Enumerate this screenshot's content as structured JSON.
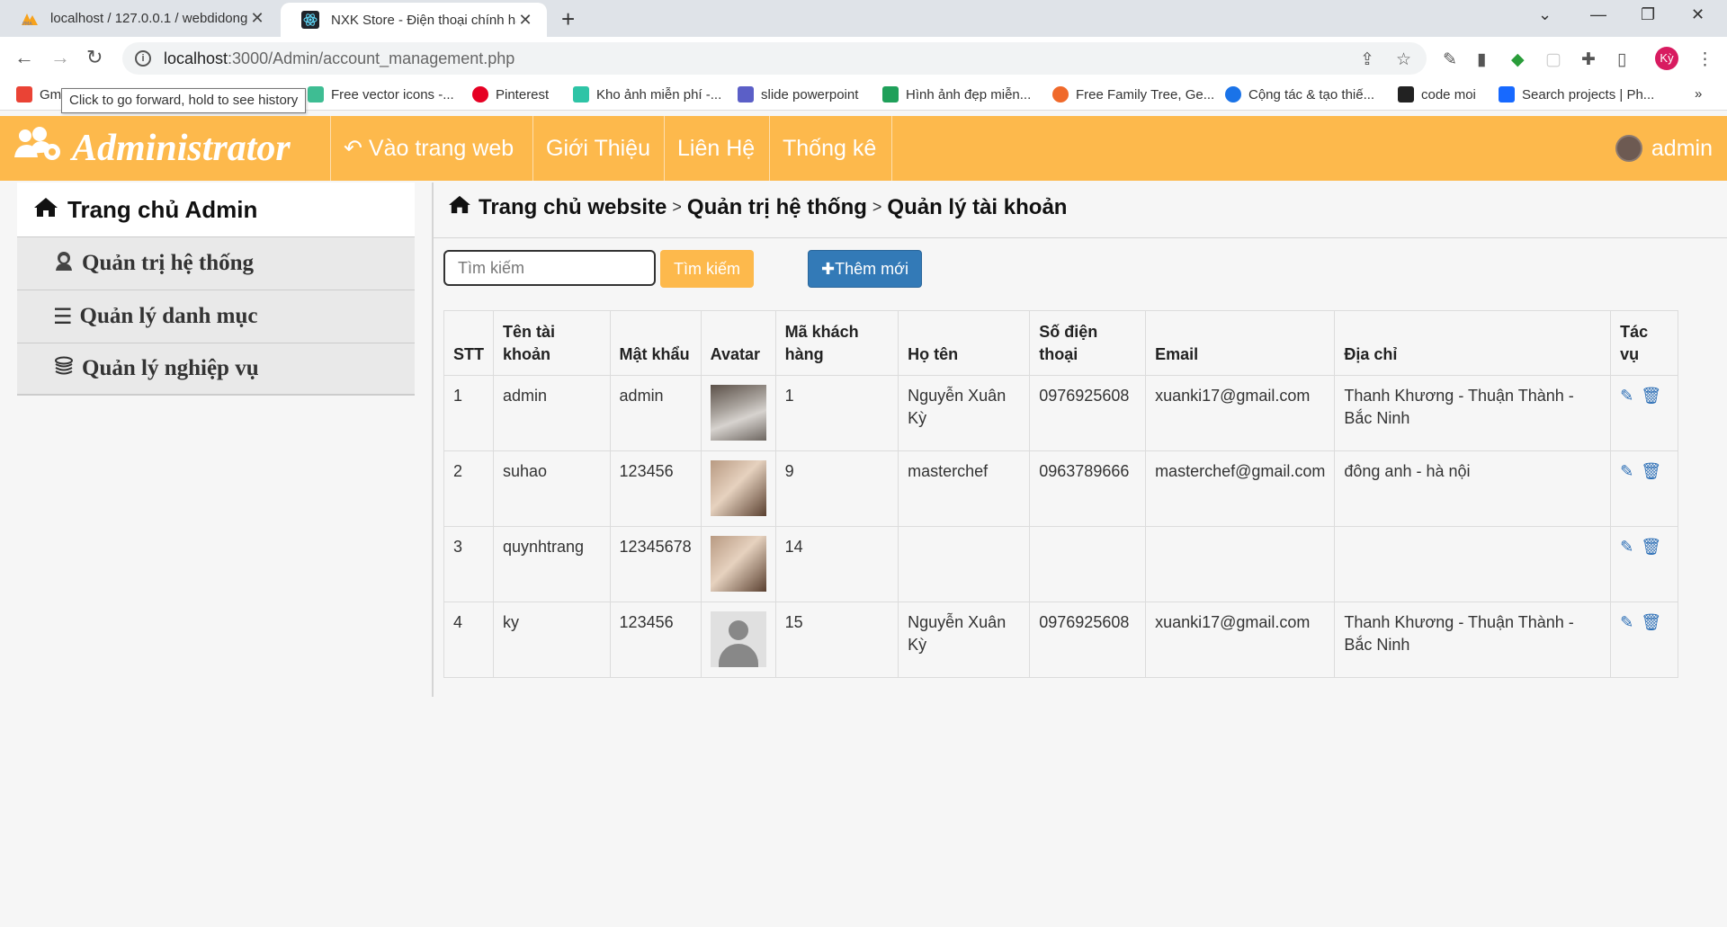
{
  "browser": {
    "tabs": [
      {
        "title": "localhost / 127.0.0.1 / webdidong",
        "icon": "phpmyadmin-icon"
      },
      {
        "title": "NXK Store - Điện thoại chính hãn",
        "icon": "react-icon"
      }
    ],
    "url_host": "localhost",
    "url_path": ":3000/Admin/account_management.php",
    "profile_initials": "Kỳ",
    "tooltip": "Click to go forward, hold to see history",
    "bookmarks": [
      {
        "label": "Gm",
        "color": "#ea4335"
      },
      {
        "label": "Free vector icons -...",
        "color": "#3ebd93"
      },
      {
        "label": "Pinterest",
        "color": "#e60023"
      },
      {
        "label": "Kho ảnh miễn phí -...",
        "color": "#2ec4a6"
      },
      {
        "label": "slide powerpoint",
        "color": "#5b5fc7"
      },
      {
        "label": "Hình ảnh đẹp miễn...",
        "color": "#1fa05a"
      },
      {
        "label": "Free Family Tree, Ge...",
        "color": "#f0692a"
      },
      {
        "label": "Cộng tác & tạo thiế...",
        "color": "#1a73e8"
      },
      {
        "label": "code moi",
        "color": "#222222"
      },
      {
        "label": "Search projects | Ph...",
        "color": "#1769ff"
      }
    ]
  },
  "header": {
    "brand": "Administrator",
    "nav": [
      "Vào trang web",
      "Giới Thiệu",
      "Liên Hệ",
      "Thống kê"
    ],
    "user": "admin",
    "accent_color": "#fdb94c"
  },
  "sidebar": {
    "home": "Trang chủ Admin",
    "items": [
      "Quản trị hệ thống",
      "Quản lý danh mục",
      "Quản lý nghiệp vụ"
    ]
  },
  "breadcrumb": [
    "Trang chủ website",
    "Quản trị hệ thống",
    "Quản lý tài khoản"
  ],
  "search": {
    "placeholder": "Tìm kiếm",
    "value": "",
    "button": "Tìm kiếm"
  },
  "add_button": "Thêm mới",
  "table": {
    "headers": [
      "STT",
      "Tên tài khoản",
      "Mật khẩu",
      "Avatar",
      "Mã khách hàng",
      "Họ tên",
      "Số điện thoại",
      "Email",
      "Địa chỉ",
      "Tác vụ"
    ],
    "rows": [
      {
        "stt": "1",
        "username": "admin",
        "password": "admin",
        "avatar": "room-photo",
        "customer_id": "1",
        "name": "Nguyễn Xuân Kỳ",
        "phone": "0976925608",
        "email": "xuanki17@gmail.com",
        "address": "Thanh Khương - Thuận Thành - Bắc Ninh"
      },
      {
        "stt": "2",
        "username": "suhao",
        "password": "123456",
        "avatar": "portrait-photo",
        "customer_id": "9",
        "name": "masterchef",
        "phone": "0963789666",
        "email": "masterchef@gmail.com",
        "address": "đông anh - hà nội"
      },
      {
        "stt": "3",
        "username": "quynhtrang",
        "password": "12345678",
        "avatar": "portrait-photo",
        "customer_id": "14",
        "name": "",
        "phone": "",
        "email": "",
        "address": ""
      },
      {
        "stt": "4",
        "username": "ky",
        "password": "123456",
        "avatar": "default-user",
        "customer_id": "15",
        "name": "Nguyễn Xuân Kỳ",
        "phone": "0976925608",
        "email": "xuanki17@gmail.com",
        "address": "Thanh Khương - Thuận Thành - Bắc Ninh"
      }
    ]
  }
}
